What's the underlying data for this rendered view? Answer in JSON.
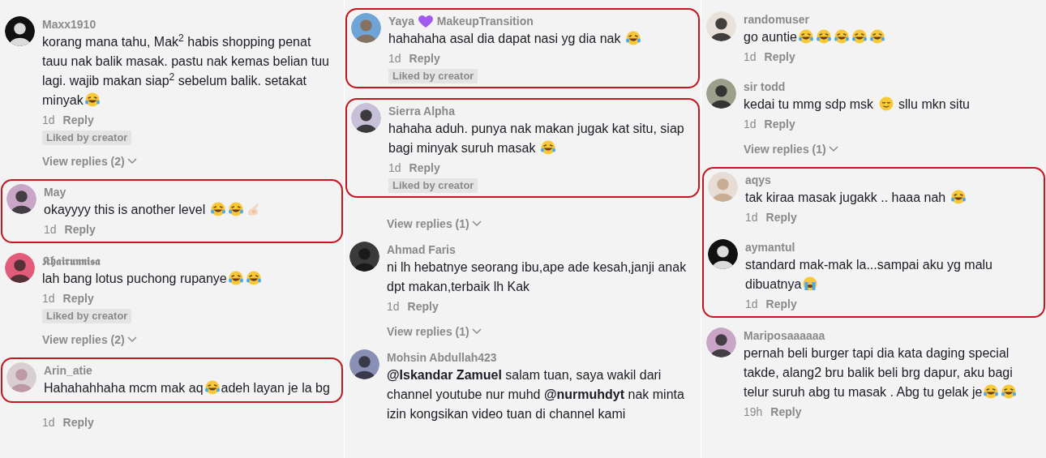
{
  "columns": [
    {
      "blocks": [
        {
          "highlighted": false,
          "comments": [
            {
              "user": [
                {
                  "kind": "text",
                  "text": "Maxx1910"
                }
              ],
              "body": [
                {
                  "kind": "text",
                  "text": "korang mana tahu, Mak$^{2}$ habis shopping penat tauu nak balik masak. pastu nak kemas belian tuu lagi. wajib makan siap$^{2}$ sebelum balik. setakat minyak"
                },
                {
                  "kind": "laugh"
                }
              ],
              "time": "1d",
              "reply": "Reply",
              "badge": "Liked by creator",
              "view_replies": "View replies (2)"
            }
          ]
        },
        {
          "highlighted": true,
          "comments": [
            {
              "user": [
                {
                  "kind": "text",
                  "text": "May"
                }
              ],
              "body": [
                {
                  "kind": "text",
                  "text": "okayyyy this is another level "
                },
                {
                  "kind": "laugh"
                },
                {
                  "kind": "laugh"
                },
                {
                  "kind": "ok"
                }
              ],
              "time": "1d",
              "reply": "Reply"
            }
          ]
        },
        {
          "highlighted": false,
          "comments": [
            {
              "user": [
                {
                  "kind": "text",
                  "text": "𝕶𝖍𝖆𝖎𝖗𝖚𝖓𝖓𝖎𝖘𝖆"
                }
              ],
              "body": [
                {
                  "kind": "text",
                  "text": "lah bang lotus puchong rupanye"
                },
                {
                  "kind": "laugh"
                },
                {
                  "kind": "laugh"
                }
              ],
              "time": "1d",
              "reply": "Reply",
              "badge": "Liked by creator",
              "view_replies": "View replies (2)"
            }
          ]
        },
        {
          "highlighted": true,
          "comments": [
            {
              "user": [
                {
                  "kind": "text",
                  "text": "Arin_atie"
                }
              ],
              "body": [
                {
                  "kind": "text",
                  "text": "Hahahahhaha mcm mak aq"
                },
                {
                  "kind": "laugh"
                },
                {
                  "kind": "text",
                  "text": "adeh layan je la bg"
                }
              ]
            }
          ]
        },
        {
          "highlighted": false,
          "comments": [
            {
              "time": "1d",
              "reply": "Reply"
            }
          ]
        }
      ]
    },
    {
      "blocks": [
        {
          "highlighted": true,
          "comments": [
            {
              "user": [
                {
                  "kind": "text",
                  "text": "Yaya "
                },
                {
                  "kind": "heart"
                },
                {
                  "kind": "text",
                  "text": " MakeupTransition"
                }
              ],
              "body": [
                {
                  "kind": "text",
                  "text": "hahahaha asal dia dapat nasi yg dia nak "
                },
                {
                  "kind": "laugh"
                }
              ],
              "time": "1d",
              "reply": "Reply",
              "badge": "Liked by creator"
            }
          ]
        },
        {
          "highlighted": true,
          "comments": [
            {
              "user": [
                {
                  "kind": "text",
                  "text": "Sierra Alpha"
                }
              ],
              "body": [
                {
                  "kind": "text",
                  "text": "hahaha aduh. punya nak makan jugak kat situ, siap bagi minyak suruh masak "
                },
                {
                  "kind": "laugh"
                }
              ],
              "time": "1d",
              "reply": "Reply",
              "badge": "Liked by creator"
            }
          ]
        },
        {
          "highlighted": false,
          "comments": [
            {
              "view_replies": "View replies (1)"
            }
          ]
        },
        {
          "highlighted": false,
          "comments": [
            {
              "user": [
                {
                  "kind": "text",
                  "text": "Ahmad Faris"
                }
              ],
              "body": [
                {
                  "kind": "text",
                  "text": "ni lh hebatnye seorang ibu,ape ade kesah,janji anak dpt makan,terbaik lh Kak"
                }
              ],
              "time": "1d",
              "reply": "Reply",
              "view_replies": "View replies (1)"
            }
          ]
        },
        {
          "highlighted": false,
          "comments": [
            {
              "user": [
                {
                  "kind": "text",
                  "text": "Mohsin Abdullah423"
                }
              ],
              "body": [
                {
                  "kind": "text",
                  "text": "**@Iskandar Zamuel** salam tuan, saya wakil dari channel youtube nur muhd **@nurmuhdyt** nak minta izin kongsikan video tuan di channel kami"
                }
              ]
            }
          ]
        }
      ]
    },
    {
      "blocks": [
        {
          "highlighted": false,
          "comments": [
            {
              "user": [
                {
                  "kind": "text",
                  "text": "randomuser"
                }
              ],
              "body": [
                {
                  "kind": "text",
                  "text": "go auntie"
                },
                {
                  "kind": "laugh"
                },
                {
                  "kind": "laugh"
                },
                {
                  "kind": "laugh"
                },
                {
                  "kind": "laugh"
                },
                {
                  "kind": "laugh"
                }
              ],
              "time": "1d",
              "reply": "Reply"
            },
            {
              "user": [
                {
                  "kind": "text",
                  "text": "sir todd"
                }
              ],
              "body": [
                {
                  "kind": "text",
                  "text": "kedai tu mmg sdp msk "
                },
                {
                  "kind": "smile"
                },
                {
                  "kind": "text",
                  "text": " sllu mkn situ"
                }
              ],
              "time": "1d",
              "reply": "Reply",
              "view_replies": "View replies (1)"
            }
          ]
        },
        {
          "highlighted": true,
          "comments": [
            {
              "user": [
                {
                  "kind": "text",
                  "text": "aqys"
                }
              ],
              "body": [
                {
                  "kind": "text",
                  "text": "tak kiraa masak jugakk .. haaa nah "
                },
                {
                  "kind": "laugh"
                }
              ],
              "time": "1d",
              "reply": "Reply"
            },
            {
              "user": [
                {
                  "kind": "text",
                  "text": "aymantul"
                }
              ],
              "body": [
                {
                  "kind": "text",
                  "text": "standard mak-mak la...sampai aku yg malu dibuatnya"
                },
                {
                  "kind": "cry"
                }
              ],
              "time": "1d",
              "reply": "Reply"
            }
          ]
        },
        {
          "highlighted": false,
          "comments": [
            {
              "user": [
                {
                  "kind": "text",
                  "text": "Mariposaaaaaa"
                }
              ],
              "body": [
                {
                  "kind": "text",
                  "text": "pernah beli burger tapi dia kata daging special takde, alang2 bru balik beli brg dapur, aku bagi telur suruh abg tu masak . Abg tu gelak je"
                },
                {
                  "kind": "laugh"
                },
                {
                  "kind": "laugh"
                }
              ],
              "time": "19h",
              "reply": "Reply"
            }
          ]
        }
      ]
    }
  ]
}
